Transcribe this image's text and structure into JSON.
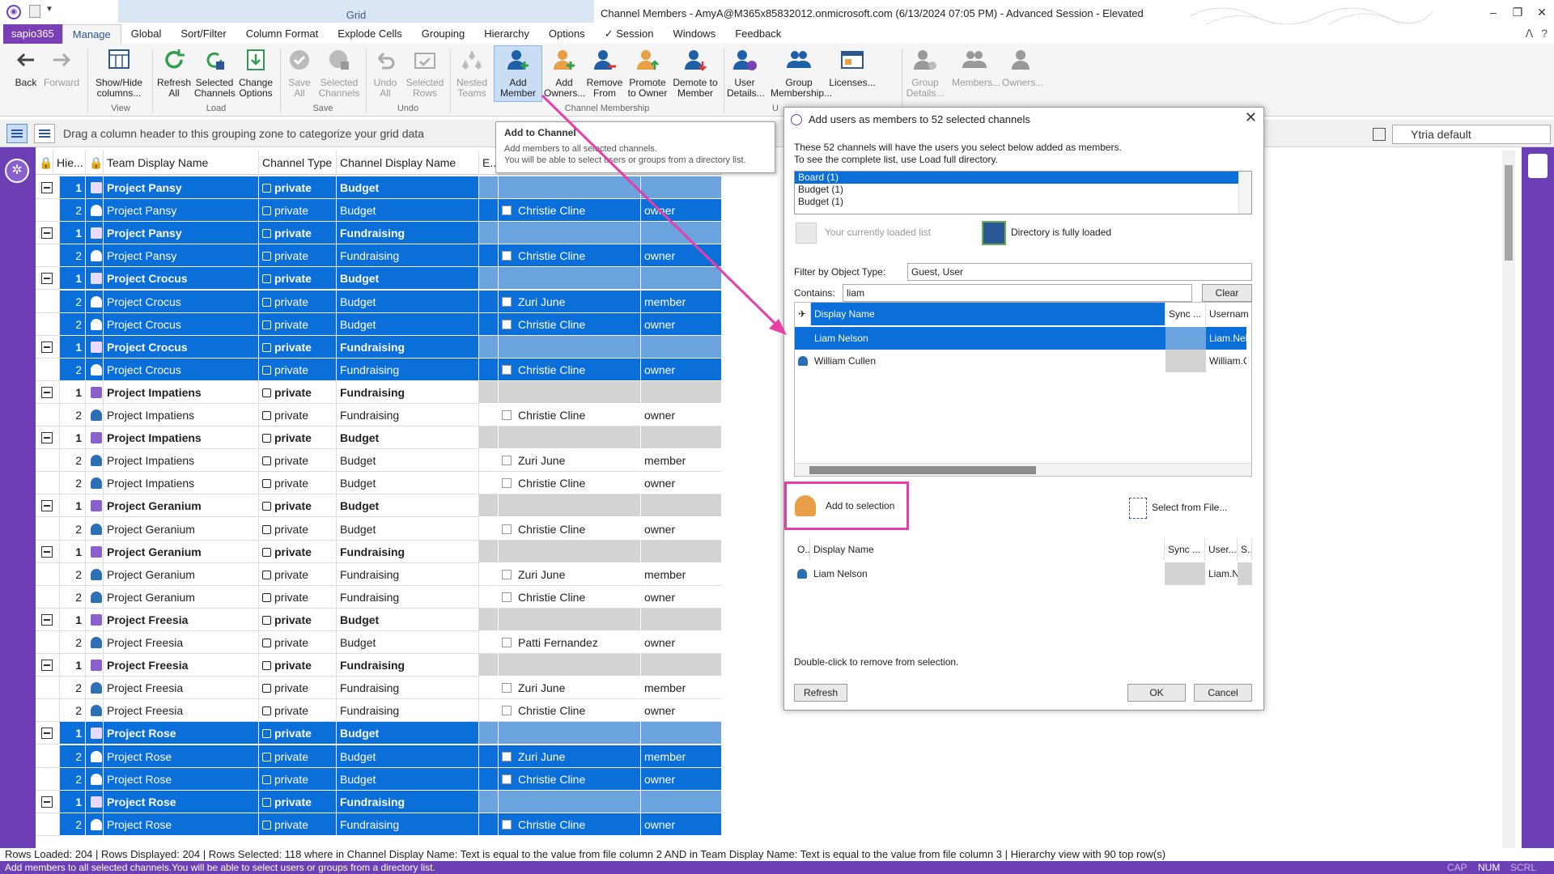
{
  "window": {
    "title": "Channel Members - AmyA@M365x85832012.onmicrosoft.com (6/13/2024 07:05 PM) - Advanced Session - Elevated",
    "context_tab": "Grid",
    "btn_minimize": "–",
    "btn_restore": "❐",
    "btn_close": "✕"
  },
  "ribbon_tabs": [
    "sapio365",
    "Manage",
    "Global",
    "Sort/Filter",
    "Column Format",
    "Explode Cells",
    "Grouping",
    "Hierarchy",
    "Options",
    "✓ Session",
    "Windows",
    "Feedback"
  ],
  "ribbon_right": {
    "collapse": "ᐱ",
    "help": "?"
  },
  "ribbon": {
    "back": "Back",
    "forward": "Forward",
    "show_hide": "Show/Hide columns...",
    "refresh_all": "Refresh All",
    "selected_channels": "Selected Channels",
    "change_options": "Change Options",
    "save_all": "Save All",
    "save_selected": "Selected Channels",
    "undo_all": "Undo All",
    "undo_rows": "Selected Rows",
    "nested_teams": "Nested Teams",
    "add_member": "Add Member",
    "add_owners": "Add Owners...",
    "remove_from": "Remove From",
    "promote_owner": "Promote to Owner",
    "demote_member": "Demote to Member",
    "user_details": "User Details...",
    "group_membership": "Group Membership...",
    "licenses": "Licenses...",
    "group_details": "Group Details...",
    "members": "Members...",
    "owners": "Owners...",
    "groups": {
      "view": "View",
      "load": "Load",
      "save": "Save",
      "undo": "Undo",
      "channel_membership": "Channel Membership",
      "users": "U"
    }
  },
  "tooltip": {
    "title": "Add to Channel",
    "body": "Add members to all selected channels.\nYou will be able to select users or groups from a directory list."
  },
  "groupbar": {
    "hint": "Drag a column header to this grouping zone to categorize your grid data",
    "layout": "Ytria default"
  },
  "grid": {
    "headers": [
      "Hie...",
      "Team Display Name",
      "Channel Type",
      "Channel Display Name",
      "E...",
      "",
      ""
    ],
    "rows": [
      {
        "level": "1",
        "team": "Project Pansy",
        "type": "private",
        "channel": "Budget",
        "user": "",
        "role": "",
        "parent": true,
        "selected": true
      },
      {
        "level": "2",
        "team": "Project Pansy",
        "type": "private",
        "channel": "Budget",
        "user": "Christie Cline",
        "role": "owner",
        "parent": false,
        "selected": true
      },
      {
        "level": "1",
        "team": "Project Pansy",
        "type": "private",
        "channel": "Fundraising",
        "user": "",
        "role": "",
        "parent": true,
        "selected": true
      },
      {
        "level": "2",
        "team": "Project Pansy",
        "type": "private",
        "channel": "Fundraising",
        "user": "Christie Cline",
        "role": "owner",
        "parent": false,
        "selected": true
      },
      {
        "level": "1",
        "team": "Project Crocus",
        "type": "private",
        "channel": "Budget",
        "user": "",
        "role": "",
        "parent": true,
        "selected": true
      },
      {
        "level": "2",
        "team": "Project Crocus",
        "type": "private",
        "channel": "Budget",
        "user": "Zuri June",
        "role": "member",
        "parent": false,
        "selected": true
      },
      {
        "level": "2",
        "team": "Project Crocus",
        "type": "private",
        "channel": "Budget",
        "user": "Christie Cline",
        "role": "owner",
        "parent": false,
        "selected": true
      },
      {
        "level": "1",
        "team": "Project Crocus",
        "type": "private",
        "channel": "Fundraising",
        "user": "",
        "role": "",
        "parent": true,
        "selected": true
      },
      {
        "level": "2",
        "team": "Project Crocus",
        "type": "private",
        "channel": "Fundraising",
        "user": "Christie Cline",
        "role": "owner",
        "parent": false,
        "selected": true
      },
      {
        "level": "1",
        "team": "Project Impatiens",
        "type": "private",
        "channel": "Fundraising",
        "user": "",
        "role": "",
        "parent": true,
        "selected": false
      },
      {
        "level": "2",
        "team": "Project Impatiens",
        "type": "private",
        "channel": "Fundraising",
        "user": "Christie Cline",
        "role": "owner",
        "parent": false,
        "selected": false
      },
      {
        "level": "1",
        "team": "Project Impatiens",
        "type": "private",
        "channel": "Budget",
        "user": "",
        "role": "",
        "parent": true,
        "selected": false
      },
      {
        "level": "2",
        "team": "Project Impatiens",
        "type": "private",
        "channel": "Budget",
        "user": "Zuri June",
        "role": "member",
        "parent": false,
        "selected": false
      },
      {
        "level": "2",
        "team": "Project Impatiens",
        "type": "private",
        "channel": "Budget",
        "user": "Christie Cline",
        "role": "owner",
        "parent": false,
        "selected": false
      },
      {
        "level": "1",
        "team": "Project Geranium",
        "type": "private",
        "channel": "Budget",
        "user": "",
        "role": "",
        "parent": true,
        "selected": false
      },
      {
        "level": "2",
        "team": "Project Geranium",
        "type": "private",
        "channel": "Budget",
        "user": "Christie Cline",
        "role": "owner",
        "parent": false,
        "selected": false
      },
      {
        "level": "1",
        "team": "Project Geranium",
        "type": "private",
        "channel": "Fundraising",
        "user": "",
        "role": "",
        "parent": true,
        "selected": false
      },
      {
        "level": "2",
        "team": "Project Geranium",
        "type": "private",
        "channel": "Fundraising",
        "user": "Zuri June",
        "role": "member",
        "parent": false,
        "selected": false
      },
      {
        "level": "2",
        "team": "Project Geranium",
        "type": "private",
        "channel": "Fundraising",
        "user": "Christie Cline",
        "role": "owner",
        "parent": false,
        "selected": false
      },
      {
        "level": "1",
        "team": "Project Freesia",
        "type": "private",
        "channel": "Budget",
        "user": "",
        "role": "",
        "parent": true,
        "selected": false
      },
      {
        "level": "2",
        "team": "Project Freesia",
        "type": "private",
        "channel": "Budget",
        "user": "Patti Fernandez",
        "role": "owner",
        "parent": false,
        "selected": false
      },
      {
        "level": "1",
        "team": "Project Freesia",
        "type": "private",
        "channel": "Fundraising",
        "user": "",
        "role": "",
        "parent": true,
        "selected": false
      },
      {
        "level": "2",
        "team": "Project Freesia",
        "type": "private",
        "channel": "Fundraising",
        "user": "Zuri June",
        "role": "member",
        "parent": false,
        "selected": false
      },
      {
        "level": "2",
        "team": "Project Freesia",
        "type": "private",
        "channel": "Fundraising",
        "user": "Christie Cline",
        "role": "owner",
        "parent": false,
        "selected": false
      },
      {
        "level": "1",
        "team": "Project Rose",
        "type": "private",
        "channel": "Budget",
        "user": "",
        "role": "",
        "parent": true,
        "selected": true
      },
      {
        "level": "2",
        "team": "Project Rose",
        "type": "private",
        "channel": "Budget",
        "user": "Zuri June",
        "role": "member",
        "parent": false,
        "selected": true
      },
      {
        "level": "2",
        "team": "Project Rose",
        "type": "private",
        "channel": "Budget",
        "user": "Christie Cline",
        "role": "owner",
        "parent": false,
        "selected": true
      },
      {
        "level": "1",
        "team": "Project Rose",
        "type": "private",
        "channel": "Fundraising",
        "user": "",
        "role": "",
        "parent": true,
        "selected": true
      },
      {
        "level": "2",
        "team": "Project Rose",
        "type": "private",
        "channel": "Fundraising",
        "user": "Christie Cline",
        "role": "owner",
        "parent": false,
        "selected": true
      }
    ]
  },
  "dialog": {
    "title": "Add users as members to 52 selected channels",
    "close": "✕",
    "desc1": "These 52 channels will have the users you select below added as members.",
    "desc2": "To see the complete list, use Load full directory.",
    "channels": [
      "Board (1)",
      "Budget (1)",
      "Budget (1)"
    ],
    "loaded_list": "Your currently loaded list",
    "directory_loaded": "Directory is fully loaded",
    "filter_label": "Filter by Object Type:",
    "filter_value": "Guest, User",
    "contains_label": "Contains:",
    "contains_value": "liam",
    "clear": "Clear",
    "results_headers": [
      "Display Name",
      "Sync ...",
      "Usernam"
    ],
    "results": [
      {
        "name": "Liam Nelson",
        "user": "Liam.Nel",
        "selected": true
      },
      {
        "name": "William Cullen",
        "user": "William.C",
        "selected": false
      }
    ],
    "add_to_selection": "Add to selection",
    "select_from_file": "Select from File...",
    "selection_headers": [
      "O...",
      "Display Name",
      "Sync ...",
      "User...",
      "S..."
    ],
    "selection": [
      {
        "name": "Liam Nelson",
        "user": "Liam.N"
      }
    ],
    "dbl_hint": "Double-click to remove from selection.",
    "refresh": "Refresh",
    "ok": "OK",
    "cancel": "Cancel"
  },
  "status": {
    "line1": "Rows Loaded: 204 | Rows Displayed: 204 | Rows Selected: 118 where in Channel Display Name: Text is equal to the value from file column 2 AND in Team Display Name: Text is equal to the value from file column 3 | Hierarchy view with 90 top row(s)",
    "line2": "Add members to all selected channels.You will be able to select users or groups from a directory list.",
    "cap": "CAP",
    "num": "NUM",
    "scrl": "SCRL"
  },
  "colors": {
    "accent": "#6c3fb5",
    "selection": "#0a6fd8",
    "highlight": "#e83ea8"
  }
}
